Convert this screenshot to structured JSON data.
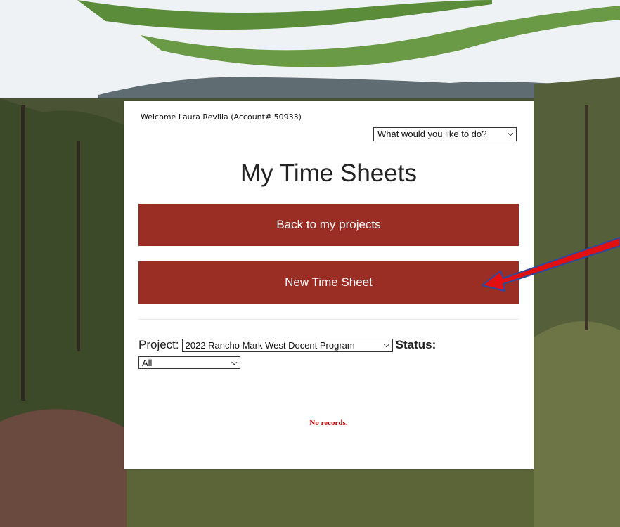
{
  "header": {
    "welcome_text": "Welcome Laura Revilla (Account# 50933)",
    "action_select_value": "What would you like to do?"
  },
  "page": {
    "title": "My Time Sheets"
  },
  "buttons": {
    "back_label": "Back to my projects",
    "new_label": "New Time Sheet"
  },
  "filters": {
    "project_label": "Project:",
    "project_value": "2022 Rancho Mark West Docent Program",
    "status_label": "Status:",
    "status_value": "All"
  },
  "results": {
    "empty_text": "No records."
  },
  "colors": {
    "button_bg": "#9a2d24",
    "empty_text": "#cc0000",
    "arrow": "#e01010",
    "arrow_outline": "#2a4aa0"
  },
  "icons": {
    "dropdown": "chevron-down-icon",
    "annotation": "red-arrow-icon"
  }
}
